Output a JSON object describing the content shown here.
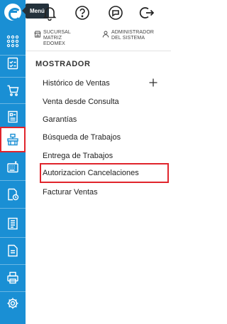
{
  "sidebar": {
    "tooltip": "Menú",
    "items": [
      {
        "icon": "apps-grid-icon"
      },
      {
        "icon": "checklist-icon"
      },
      {
        "icon": "cart-icon"
      },
      {
        "icon": "inventory-icon"
      },
      {
        "icon": "store-counter-icon",
        "active": true
      },
      {
        "icon": "cash-register-icon"
      },
      {
        "icon": "document-clock-icon"
      },
      {
        "icon": "ledger-icon"
      },
      {
        "icon": "report-icon"
      },
      {
        "icon": "printer-icon"
      },
      {
        "icon": "settings-icon"
      }
    ],
    "accent_color": "#1a8fd4"
  },
  "topbar": {
    "icons": [
      "bell-icon",
      "help-icon",
      "chat-icon",
      "logout-icon"
    ]
  },
  "info": {
    "branch_line1": "SUCURSAL",
    "branch_line2": "MATRIZ",
    "branch_line3": "EDOMEX",
    "user_line1": "ADMINISTRADOR",
    "user_line2": "DEL SISTEMA"
  },
  "menu": {
    "title": "MOSTRADOR",
    "items": [
      "Histórico de Ventas",
      "Venta desde Consulta",
      "Garantías",
      "Búsqueda de Trabajos",
      "Entrega de Trabajos",
      "Autorizacion Cancelaciones",
      "Facturar Ventas"
    ],
    "highlight_color": "#e0252c"
  }
}
